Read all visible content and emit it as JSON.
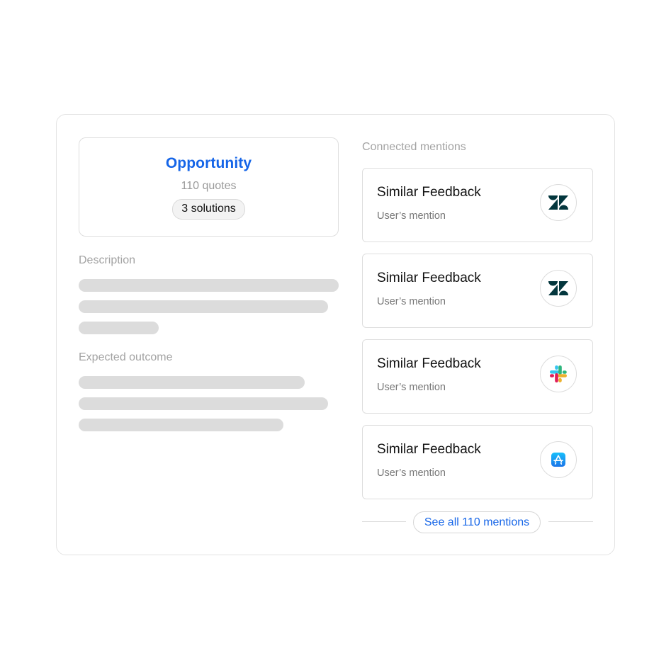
{
  "opportunity": {
    "title": "Opportunity",
    "quotes": "110 quotes",
    "solutions": "3 solutions"
  },
  "description": {
    "label": "Description"
  },
  "expected_outcome": {
    "label": "Expected outcome"
  },
  "connected_mentions": {
    "label": "Connected mentions",
    "items": [
      {
        "title": "Similar Feedback",
        "subtitle": "User’s mention",
        "icon": "zendesk-icon"
      },
      {
        "title": "Similar Feedback",
        "subtitle": "User’s mention",
        "icon": "zendesk-icon"
      },
      {
        "title": "Similar Feedback",
        "subtitle": "User’s mention",
        "icon": "slack-icon"
      },
      {
        "title": "Similar Feedback",
        "subtitle": "User’s mention",
        "icon": "app-store-icon"
      }
    ],
    "see_all_label": "See all 110 mentions"
  },
  "colors": {
    "accent": "#1565e8",
    "skeleton": "#dcdcdc",
    "muted_text": "#a3a3a3",
    "zendesk": "#03363d",
    "app_store": "#1a8cf5"
  }
}
